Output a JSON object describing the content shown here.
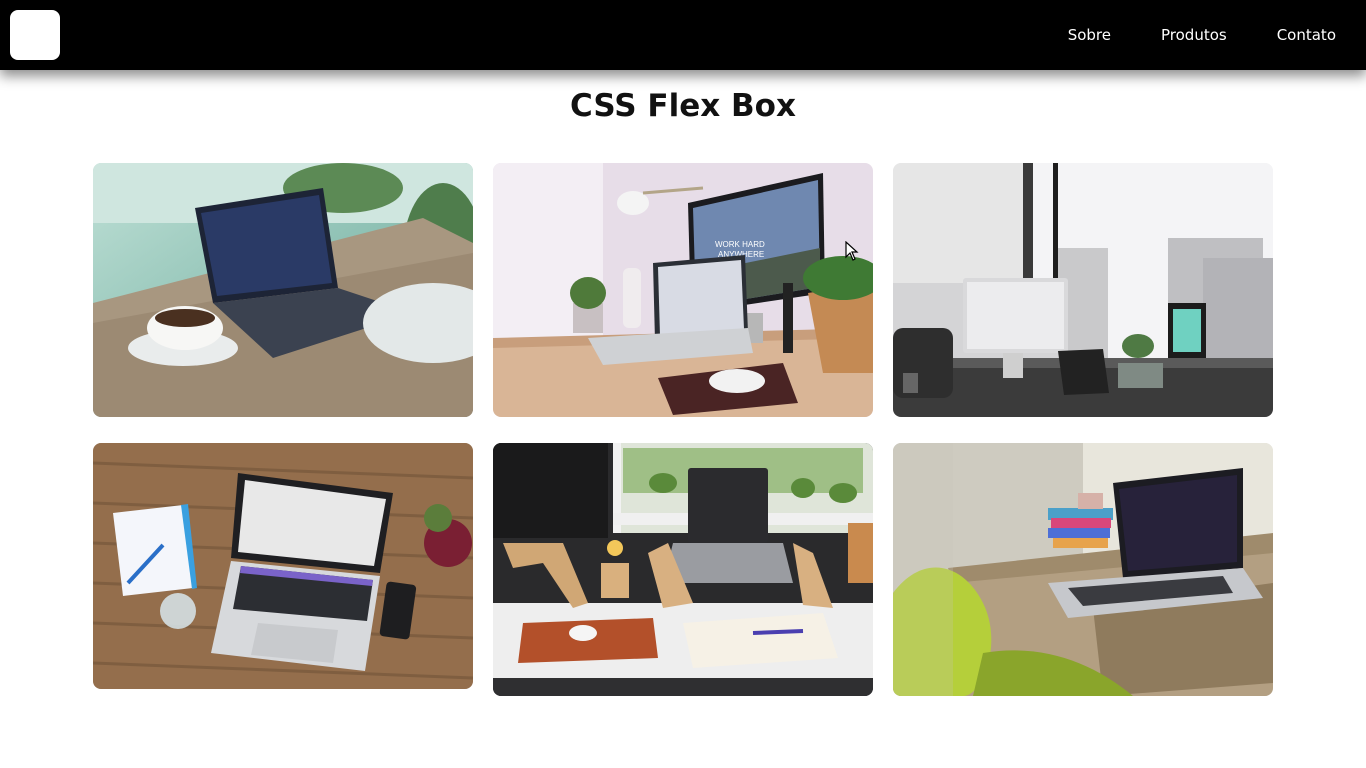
{
  "nav": {
    "links": [
      "Sobre",
      "Produtos",
      "Contato"
    ]
  },
  "main": {
    "title": "CSS Flex Box"
  },
  "gallery": {
    "cards": [
      {
        "icon": "laptop-coffee-photo"
      },
      {
        "icon": "desk-imac-photo"
      },
      {
        "icon": "office-window-photo"
      },
      {
        "icon": "laptop-wood-table-photo"
      },
      {
        "icon": "desk-laptop-stand-photo"
      },
      {
        "icon": "laptop-green-chair-photo"
      }
    ],
    "c2_screen_text": "WORK HARD\nANYWHERE"
  },
  "colors": {
    "navbar": "#000000",
    "background": "#ffffff",
    "title": "#111111"
  }
}
